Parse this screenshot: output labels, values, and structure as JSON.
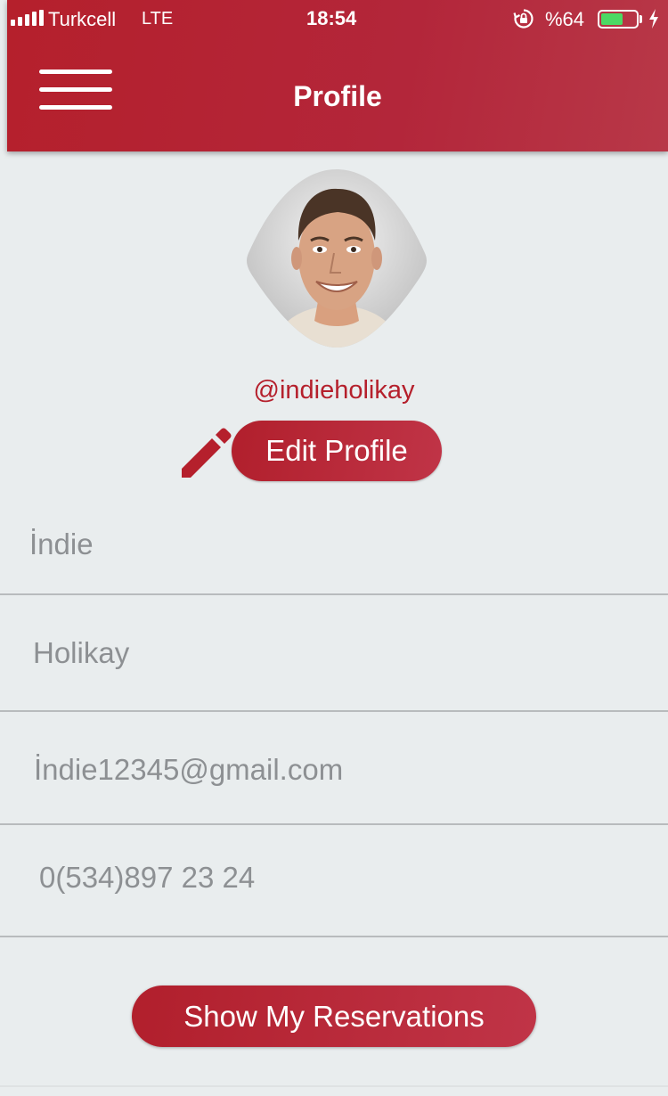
{
  "status_bar": {
    "carrier": "Turkcell",
    "network": "LTE",
    "time": "18:54",
    "battery_percent_text": "%64",
    "battery_level": 0.64,
    "icons": [
      "signal-icon",
      "orientation-lock-icon",
      "battery-icon",
      "charging-bolt-icon"
    ]
  },
  "header": {
    "title": "Profile",
    "menu_icon": "hamburger-menu-icon"
  },
  "profile": {
    "username": "@indieholikay",
    "edit_label": "Edit Profile",
    "edit_icon": "pencil-icon"
  },
  "fields": {
    "first_name": "İndie",
    "last_name": "Holikay",
    "email": "İndie12345@gmail.com",
    "phone": "0(534)897 23 24"
  },
  "actions": {
    "reservations_label": "Show My Reservations"
  },
  "colors": {
    "accent": "#b5202c",
    "background": "#e9edee",
    "field_text": "#8d9093",
    "battery_fill": "#4cd964"
  }
}
